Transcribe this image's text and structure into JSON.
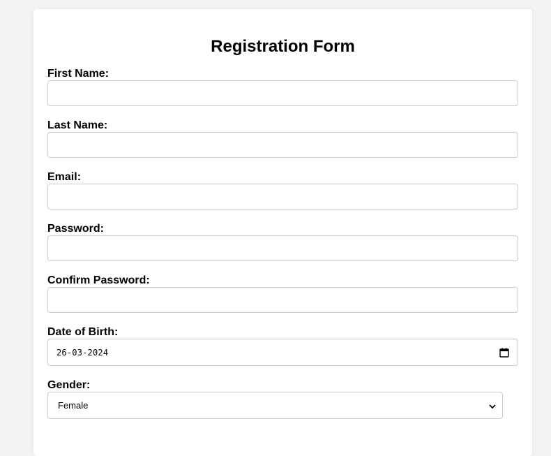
{
  "form": {
    "title": "Registration Form",
    "first_name": {
      "label": "First Name:",
      "value": ""
    },
    "last_name": {
      "label": "Last Name:",
      "value": ""
    },
    "email": {
      "label": "Email:",
      "value": ""
    },
    "password": {
      "label": "Password:",
      "value": ""
    },
    "confirm_password": {
      "label": "Confirm Password:",
      "value": ""
    },
    "dob": {
      "label": "Date of Birth:",
      "value": "26-03-2024",
      "icon": "calendar-icon"
    },
    "gender": {
      "label": "Gender:",
      "selected": "Female",
      "icon": "chevron-down-icon"
    }
  }
}
